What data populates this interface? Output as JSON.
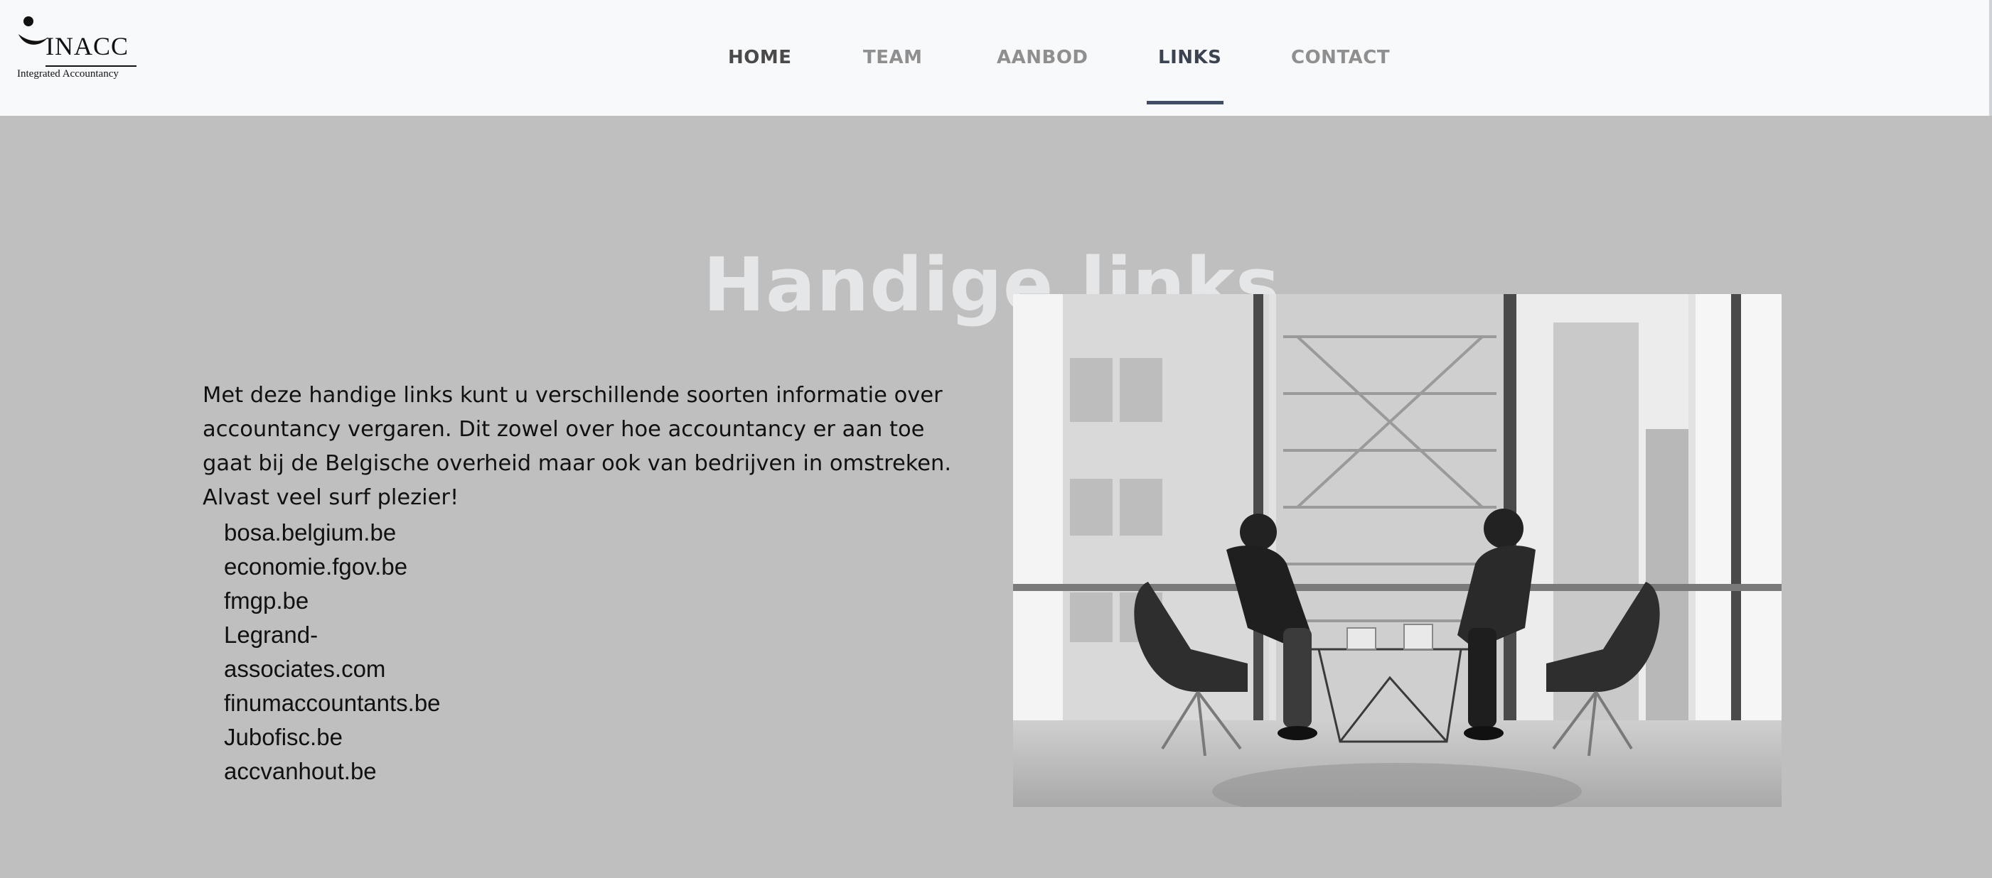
{
  "logo": {
    "name": "INACC",
    "subtitle": "Integrated Accountancy"
  },
  "nav": {
    "items": [
      {
        "label": "HOME"
      },
      {
        "label": "TEAM"
      },
      {
        "label": "AANBOD"
      },
      {
        "label": "LINKS",
        "active": true
      },
      {
        "label": "CONTACT"
      }
    ]
  },
  "main": {
    "title": "Handige links",
    "intro": "Met deze handige links kunt u verschillende soorten informatie over accountancy vergaren. Dit zowel over hoe accountancy er aan toe gaat bij de Belgische overheid maar ook van bedrijven in omstreken. Alvast veel surf plezier!",
    "links": [
      "bosa.belgium.be",
      "economie.fgov.be",
      "fmgp.be",
      "Legrand-associates.com",
      "finumaccountants.be",
      "Jubofisc.be",
      "accvanhout.be"
    ]
  },
  "colors": {
    "background": "#bfbfbf",
    "header": "#f8f9fb",
    "active_underline": "#3f4c66",
    "title": "#e5e6e8"
  }
}
